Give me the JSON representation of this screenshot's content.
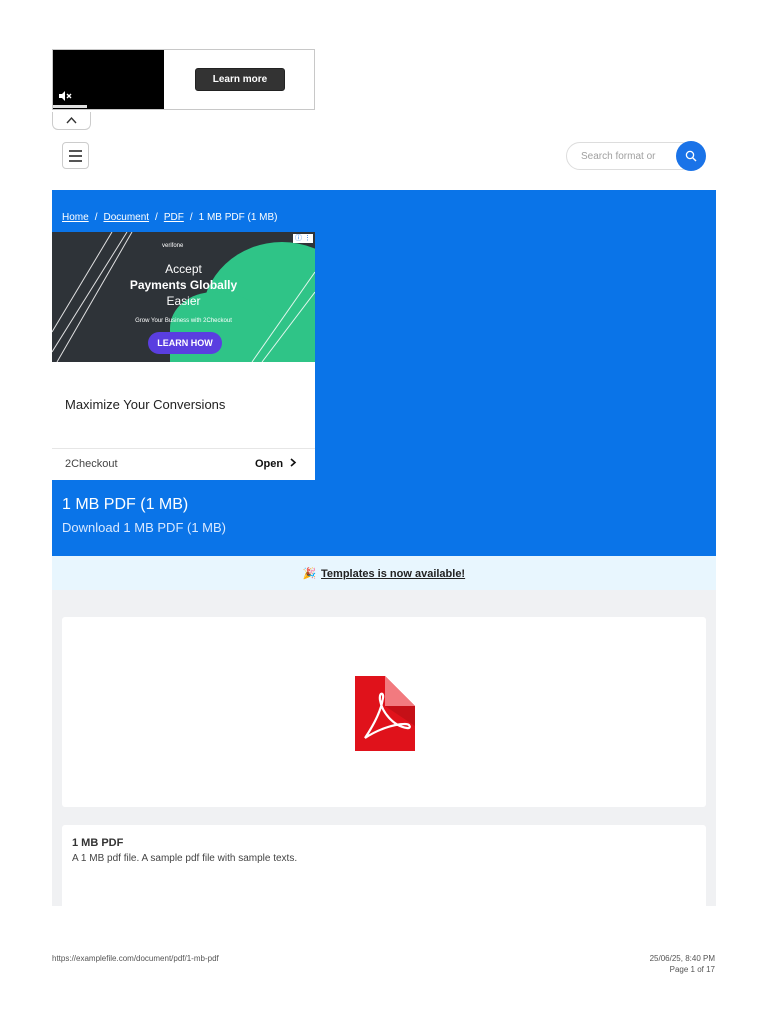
{
  "video_ad": {
    "learn_more_label": "Learn more"
  },
  "header": {
    "search_placeholder": "Search format or"
  },
  "breadcrumb": {
    "items": [
      "Home",
      "Document",
      "PDF"
    ],
    "current": "1 MB PDF (1 MB)",
    "separator": "/"
  },
  "display_ad": {
    "brand": "verifone",
    "banner_line1": "Accept",
    "banner_line2": "Payments Globally",
    "banner_line3": "Easier",
    "banner_tagline": "Grow Your Business with 2Checkout",
    "banner_cta": "LEARN HOW",
    "headline": "Maximize Your Conversions",
    "advertiser": "2Checkout",
    "open_label": "Open"
  },
  "hero": {
    "title": "1 MB PDF (1 MB)",
    "subtitle": "Download 1 MB PDF (1 MB)"
  },
  "announcement": {
    "emoji": "🎉",
    "text": "Templates is now available!"
  },
  "file_info": {
    "title": "1 MB PDF",
    "description": "A 1 MB pdf file. A sample pdf file with sample texts."
  },
  "print_footer": {
    "url": "https://examplefile.com/document/pdf/1-mb-pdf",
    "datetime": "25/06/25, 8:40 PM",
    "page": "Page 1 of 17"
  },
  "colors": {
    "brand_blue": "#0a74e8",
    "search_button": "#1a73e8",
    "announcement_bg": "#e8f6fe",
    "pdf_red": "#e0121b"
  }
}
